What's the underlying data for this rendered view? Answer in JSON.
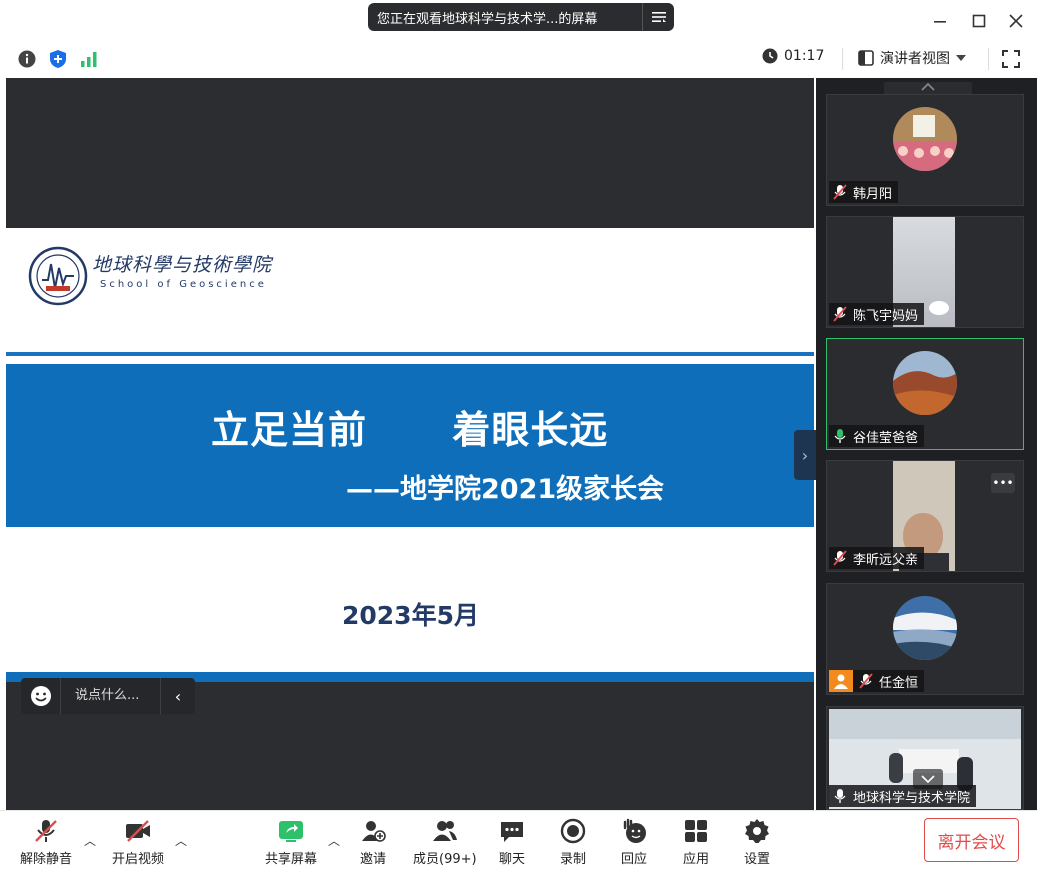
{
  "title_bar": {
    "share_notice": "您正在观看地球科学与技术学...的屏幕"
  },
  "info_bar": {
    "timer": "01:17",
    "view_mode": "演讲者视图"
  },
  "slide": {
    "logo_cn": "地球科學与技術學院",
    "logo_en": "School of Geoscience",
    "title": "立足当前      着眼长远",
    "subtitle": "——地学院2021级家长会",
    "date": "2023年5月"
  },
  "chat": {
    "placeholder": "说点什么..."
  },
  "participants": [
    {
      "name": "韩月阳",
      "audio": "muted"
    },
    {
      "name": "陈飞宇妈妈",
      "audio": "muted"
    },
    {
      "name": "谷佳莹爸爸",
      "audio": "speaking"
    },
    {
      "name": "李昕远父亲",
      "audio": "muted"
    },
    {
      "name": "任金恒",
      "audio": "muted"
    },
    {
      "name": "地球科学与技术学院",
      "audio": "on"
    }
  ],
  "toolbar": {
    "unmute": "解除静音",
    "start_video": "开启视频",
    "share_screen": "共享屏幕",
    "invite": "邀请",
    "members": "成员(99+)",
    "chat": "聊天",
    "record": "录制",
    "reactions": "回应",
    "apps": "应用",
    "settings": "设置",
    "leave": "离开会议"
  },
  "colors": {
    "accent_green": "#2ec16b",
    "slide_blue": "#0f6eb9",
    "leave_red": "#e24c4c"
  }
}
